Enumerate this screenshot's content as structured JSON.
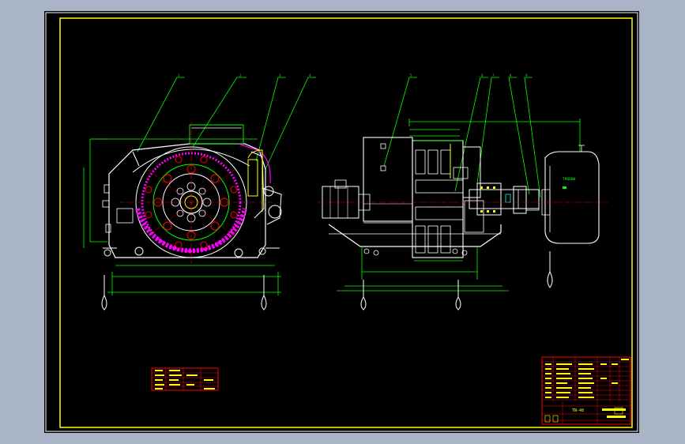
{
  "viewport": {
    "background": "#a9b5c7"
  },
  "drawing": {
    "title_block_text": "TN-48",
    "motor_nameplate_text": "TRQDB0",
    "colors": {
      "frame_outer": "#ffffff",
      "frame_inner": "#ffff00",
      "geometry": "#ffffff",
      "dimension": "#00ff00",
      "center_line": "#ff0000",
      "hatch": "#ff00ff",
      "table": "#ff0000",
      "table_text": "#ffff00",
      "cyan": "#00ffff"
    },
    "balloons": [
      "1",
      "2",
      "3",
      "4",
      "5",
      "6",
      "7",
      "8",
      "9"
    ]
  }
}
